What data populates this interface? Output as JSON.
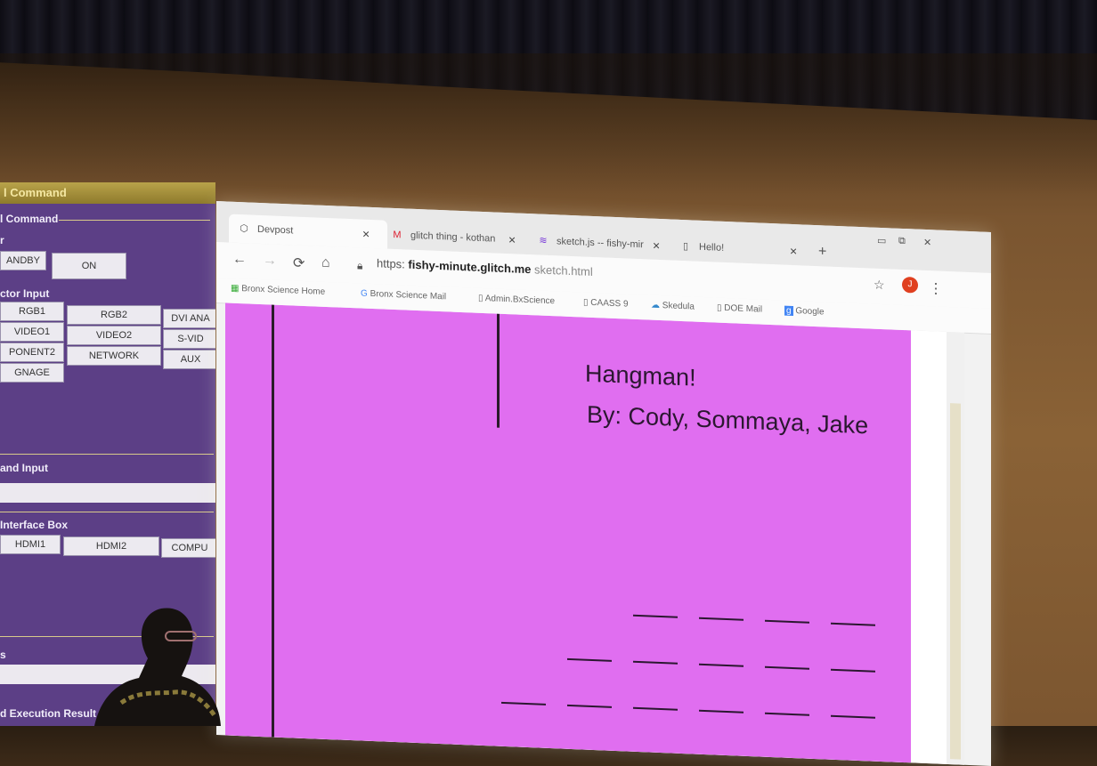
{
  "panel": {
    "title": "l Command",
    "section_command": "l Command",
    "power_label": "r",
    "standby_btn": "ANDBY",
    "on_btn": "ON",
    "projector_input_label": "ctor Input",
    "inputs": [
      "RGB1",
      "RGB2",
      "DVI ANA",
      "VIDEO1",
      "VIDEO2",
      "S-VID",
      "PONENT2",
      "NETWORK",
      "AUX",
      "GNAGE"
    ],
    "demand_input_label": "and Input",
    "interface_box_label": "Interface Box",
    "interface_buttons": [
      "HDMI1",
      "HDMI2",
      "COMPU"
    ],
    "small_label": "s",
    "execution_result_label": "d Execution Result"
  },
  "browser": {
    "tabs": [
      {
        "label": "Devpost",
        "icon": "devpost-icon"
      },
      {
        "label": "glitch thing - kothan",
        "icon": "gmail-icon"
      },
      {
        "label": "sketch.js -- fishy-mir",
        "icon": "glitch-icon"
      },
      {
        "label": "Hello!",
        "icon": "page-icon"
      }
    ],
    "new_tab": "+",
    "url": {
      "scheme": "https:",
      "host": "fishy-minute.glitch.me",
      "path": "sketch.html"
    },
    "bookmarks": [
      {
        "label": "Bronx Science Home",
        "icon": "apps-icon"
      },
      {
        "label": "Bronx Science Mail",
        "icon": "google-icon"
      },
      {
        "label": "Admin.BxScience",
        "icon": "page-icon"
      },
      {
        "label": "CAASS 9",
        "icon": "page-icon"
      },
      {
        "label": "Skedula",
        "icon": "skedula-icon"
      },
      {
        "label": "DOE Mail",
        "icon": "page-icon"
      },
      {
        "label": "Google",
        "icon": "google-g-icon"
      }
    ],
    "avatar_letter": "J"
  },
  "page": {
    "title": "Hangman!",
    "byline": "By: Cody, Sommaya, Jake",
    "word_blanks": [
      4,
      5,
      6
    ],
    "canvas_color": "#e06ef0"
  }
}
